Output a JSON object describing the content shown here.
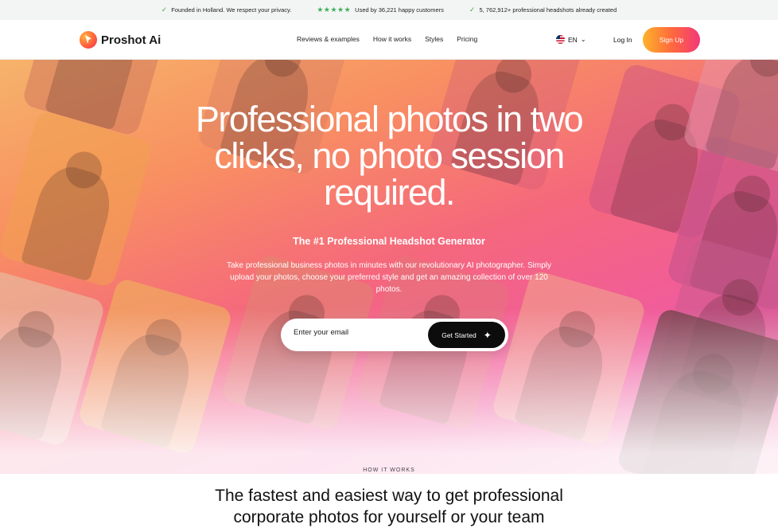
{
  "topbar": {
    "items": [
      {
        "icon": "check-icon",
        "text": "Founded in Holland. We respect your privacy."
      },
      {
        "icon": "five-stars-icon",
        "text": "Used by 36,221 happy customers"
      },
      {
        "icon": "check-icon",
        "text": "5, 762,912+ professional headshots already created"
      }
    ],
    "stars": "★★★★★"
  },
  "nav": {
    "logo_text": "Proshot Ai",
    "links": [
      "Reviews & examples",
      "How it works",
      "Styles",
      "Pricing"
    ],
    "language": "EN",
    "login": "Log In",
    "signup": "Sign Up"
  },
  "hero": {
    "title": "Professional photos in two clicks, no photo session required.",
    "subtitle": "The #1 Professional Headshot Generator",
    "description": "Take professional business photos in minutes with our revolutionary AI photographer. Simply upload your photos, choose your preferred style and get an amazing collection of over 120 photos.",
    "email_placeholder": "Enter your email",
    "cta_label": "Get Started"
  },
  "how_it_works": {
    "tag": "HOW IT WORKS",
    "title": "The fastest and easiest way to get professional corporate photos for yourself or your team"
  },
  "colors": {
    "accent_orange": "#ffb22a",
    "accent_pink": "#f2387a",
    "check_green": "#3fae5a",
    "cta_dark": "#0c0c0c"
  }
}
